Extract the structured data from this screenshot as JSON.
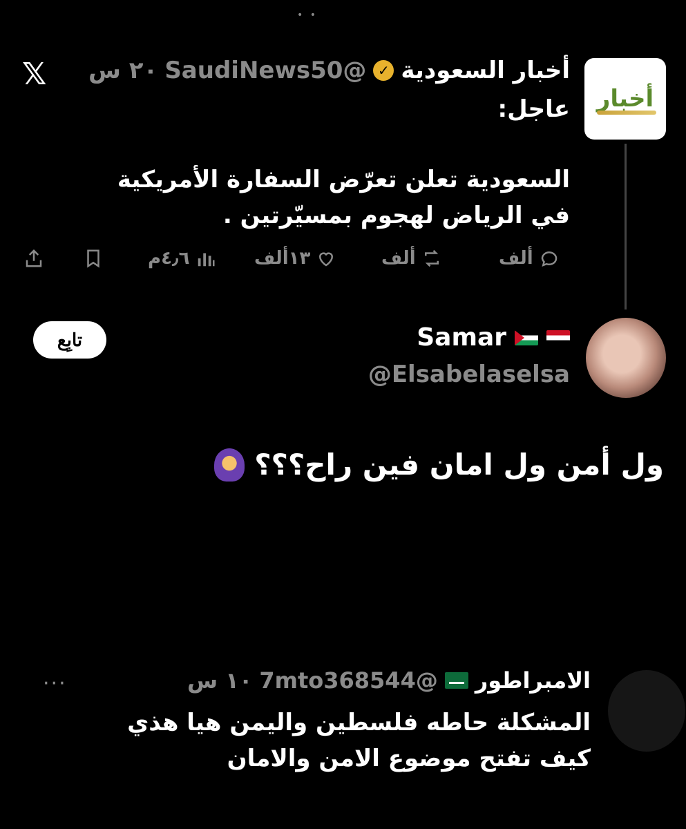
{
  "quoted_tweet": {
    "author_name": "أخبار السعودية",
    "handle": "@SaudiNews50",
    "time": "٢٠ س",
    "avatar_text": "أخبار",
    "label": "عاجل:",
    "body": "السعودية تعلن تعرّض السفارة الأمريكية في الرياض لهجوم بمسيّرتين .",
    "actions": {
      "replies": "ألف",
      "reposts": "ألف",
      "likes": "١٣ألف",
      "views": "٤٫٦م"
    }
  },
  "main_tweet": {
    "author_name": "Samar",
    "handle": "@Elsabelaselsa",
    "follow_label": "تابِع",
    "body": "ول أمن ول امان فين راح؟؟؟"
  },
  "reply": {
    "author_name": "الامبراطور",
    "handle": "@7mto368544",
    "time": "١٠ س",
    "more": "···",
    "body": "المشكلة حاطه فلسطين واليمن هيا هذي كيف تفتح موضوع الامن والامان"
  },
  "colors": {
    "background": "#000000",
    "muted_text": "#8b8b8b",
    "verified_badge": "#e8b22d"
  },
  "icons": {
    "platform": "x-logo-icon",
    "verified": "verified-badge-icon"
  }
}
